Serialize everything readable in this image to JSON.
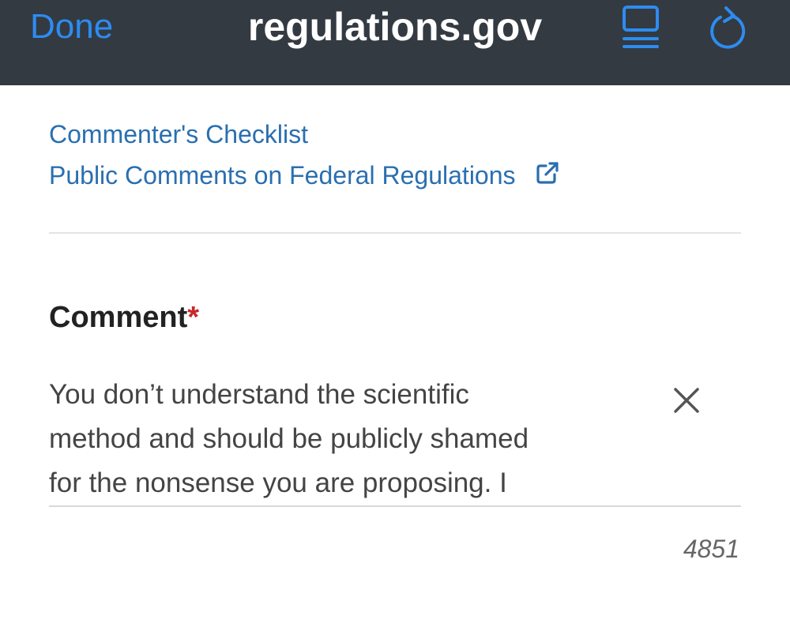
{
  "browser": {
    "done_label": "Done",
    "site_title": "regulations.gov",
    "accent_color": "#2d8cf0",
    "icons": [
      "reader-view-icon",
      "reload-icon"
    ]
  },
  "links": {
    "checklist": "Commenter's Checklist",
    "public_comments": "Public Comments on Federal Regulations",
    "public_comments_icon": "external-link-icon"
  },
  "comment": {
    "label": "Comment",
    "required_marker": "*",
    "text": "You don’t understand the scientific\nmethod and should be publicly shamed\nfor the nonsense you are proposing. I",
    "clear_icon": "close-icon",
    "chars_remaining": "4851"
  }
}
